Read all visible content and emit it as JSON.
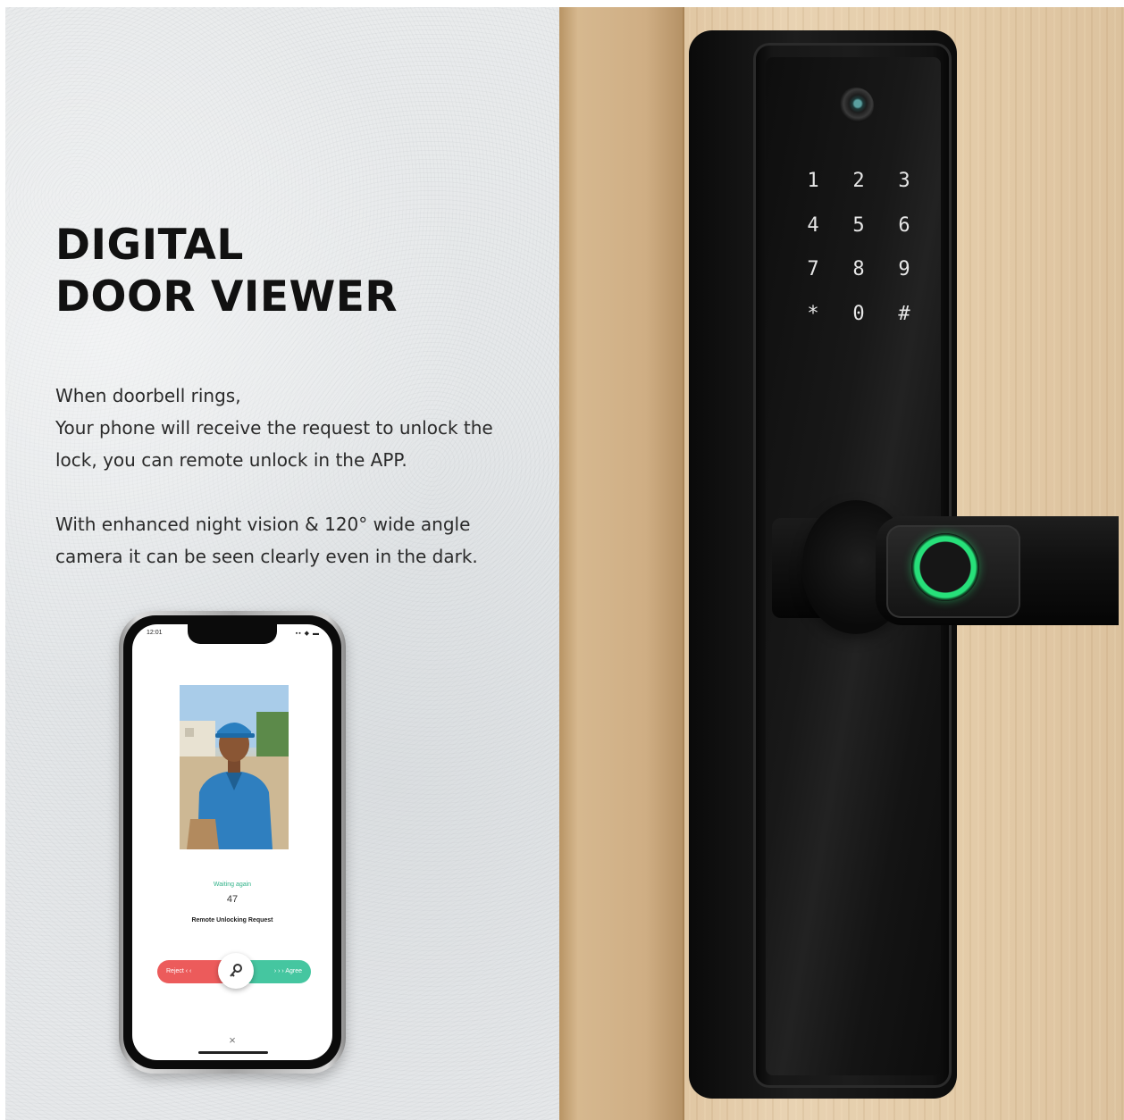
{
  "heading": {
    "line1": "DIGITAL",
    "line2": "DOOR VIEWER"
  },
  "description": {
    "paragraph1": [
      "When doorbell rings,",
      "Your phone will receive the request to unlock the",
      "lock, you can remote unlock in the APP."
    ],
    "paragraph2": [
      "With enhanced night vision & 120° wide angle",
      "camera it can be seen clearly even in the dark."
    ]
  },
  "phone": {
    "status_time": "12:01",
    "status_icons": "▪▪ ◆ ▬",
    "waiting_label": "Waiting again",
    "count": "47",
    "request_label": "Remote Unlocking Request",
    "reject_label": "Reject ‹ ‹",
    "agree_label": "› › › Agree",
    "key_icon": "key-icon",
    "close_label": "×"
  },
  "lock": {
    "keys": [
      "1",
      "2",
      "3",
      "4",
      "5",
      "6",
      "7",
      "8",
      "9",
      "*",
      "0",
      "#"
    ],
    "accent_color": "#27e07a"
  },
  "colors": {
    "reject": "#ec5b5b",
    "agree": "#45c6a0",
    "lock_body": "#111111",
    "wall": "#e6e8ea",
    "wood": "#e3c8a2"
  }
}
